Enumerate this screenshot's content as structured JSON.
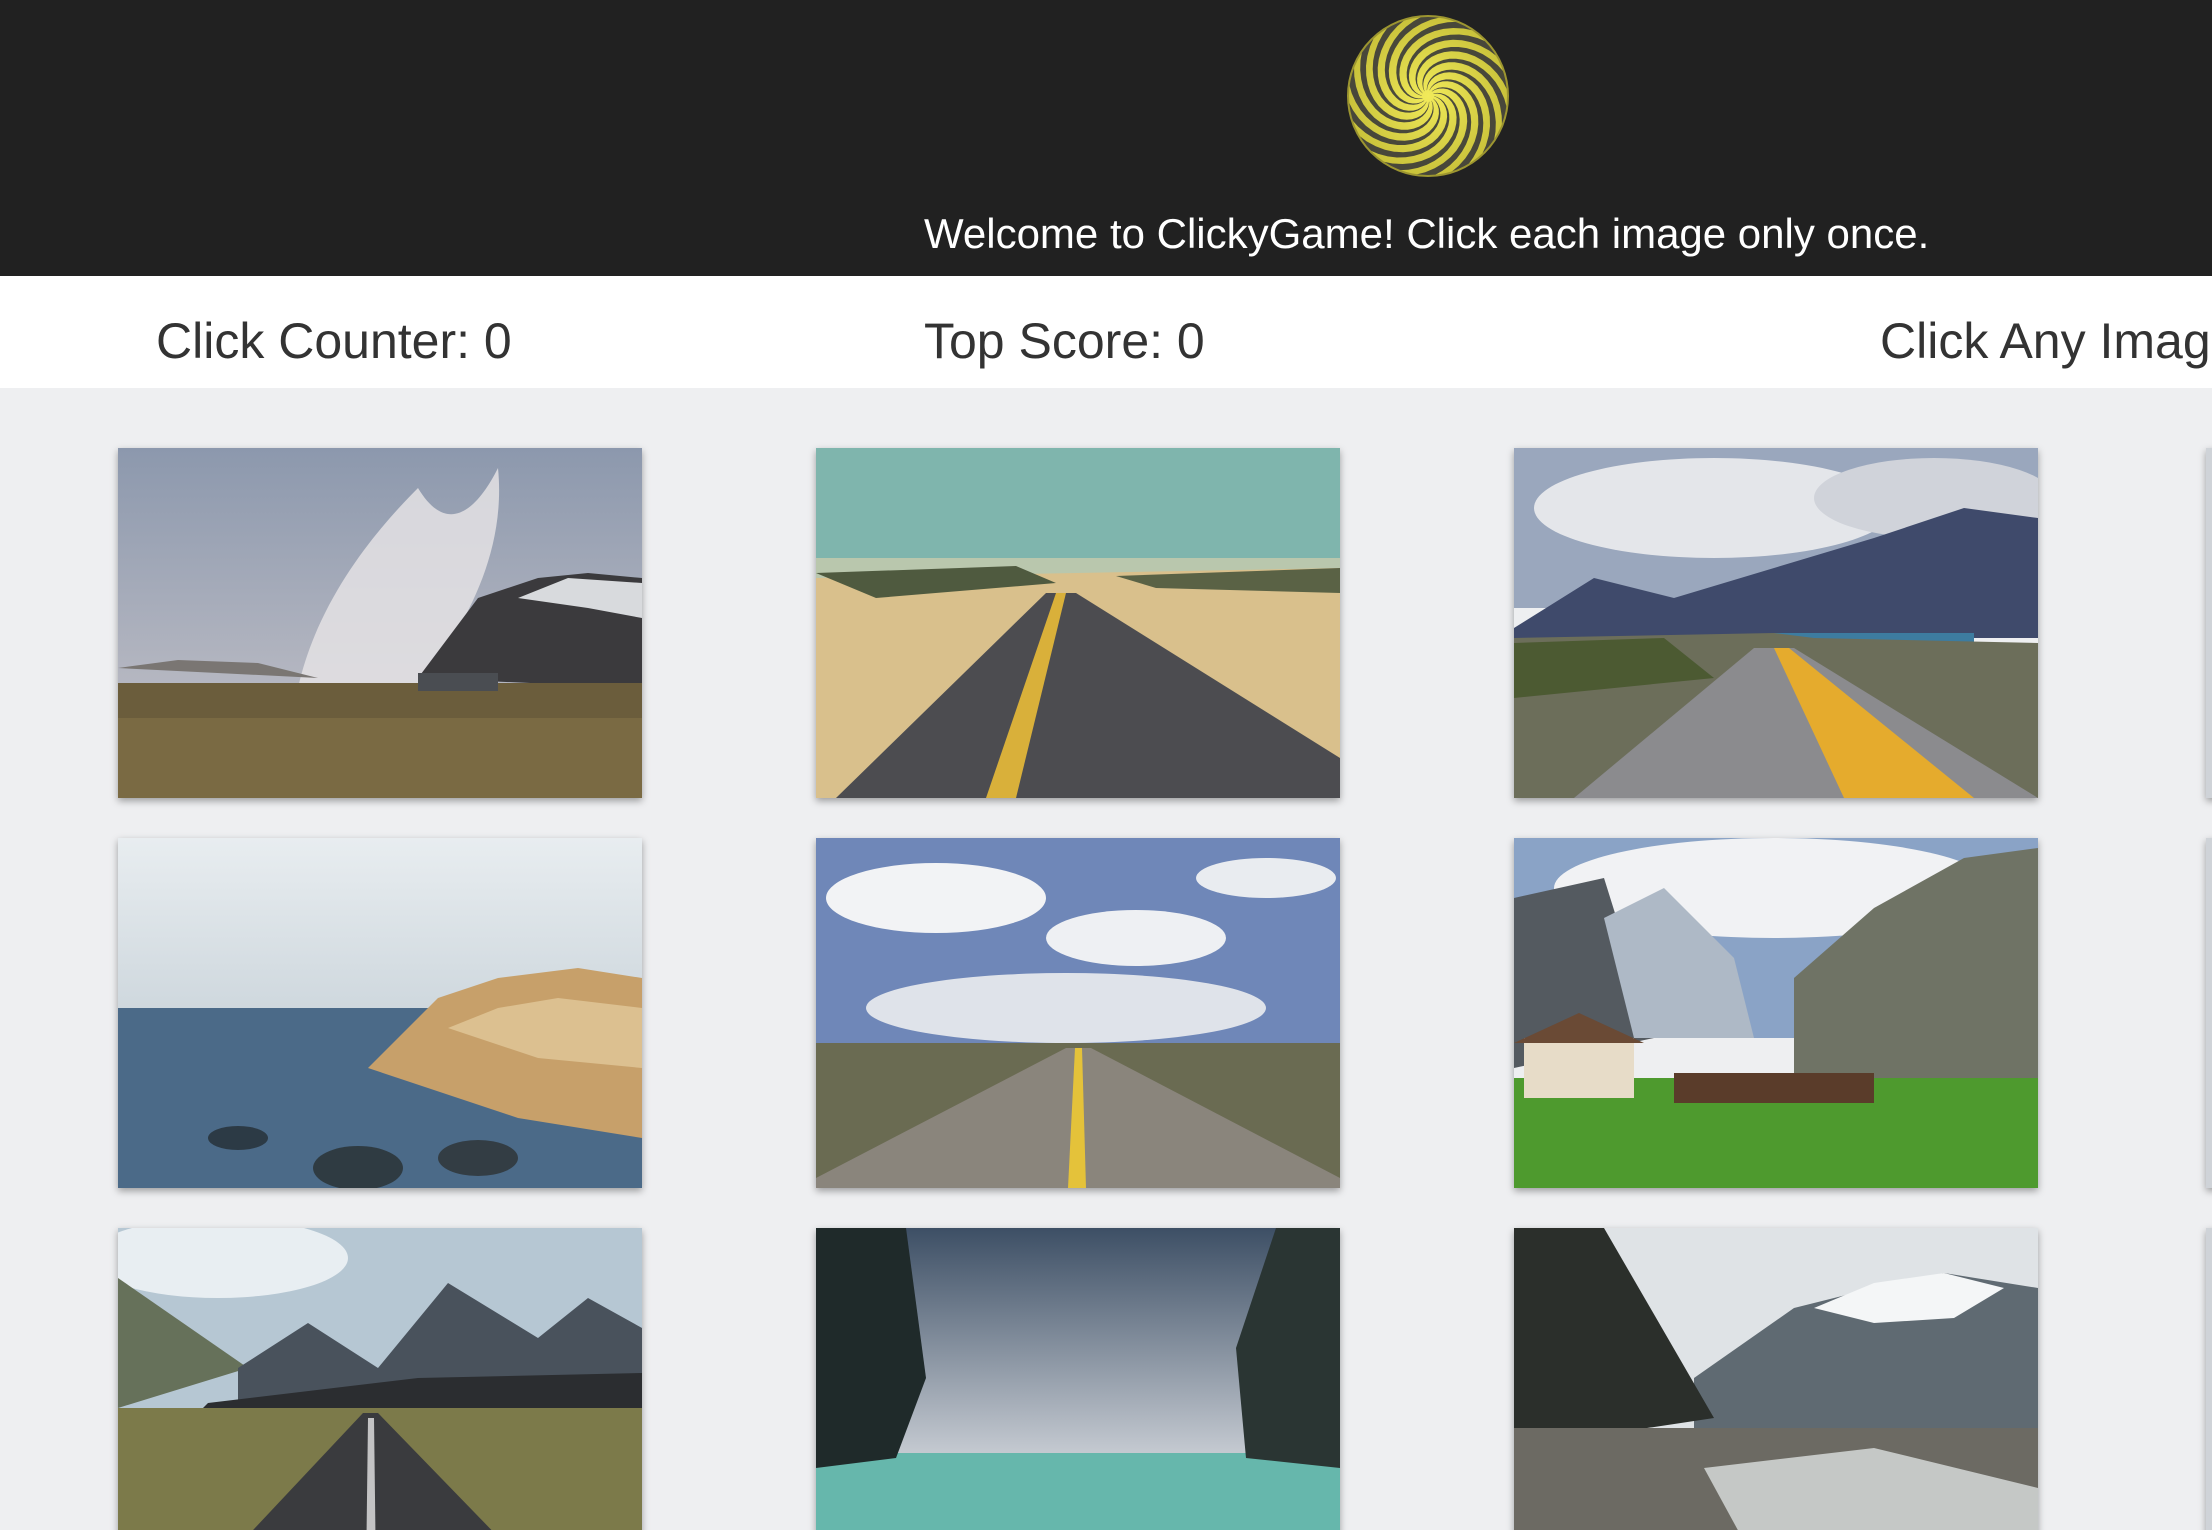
{
  "header": {
    "logo_icon": "spiral-logo-icon",
    "welcome_text": "Welcome to ClickyGame! Click each image only once."
  },
  "scoreboard": {
    "click_counter": "Click Counter: 0",
    "top_score": "Top Score: 0",
    "hint": "Click Any Image"
  },
  "gallery": {
    "tiles": [
      {
        "scene": "geothermal-steam-mountains"
      },
      {
        "scene": "desert-road-dunes"
      },
      {
        "scene": "mountain-lake-road"
      },
      {
        "scene": "rocky-sea-coast"
      },
      {
        "scene": "prairie-road-clouds"
      },
      {
        "scene": "alpine-valley-village"
      },
      {
        "scene": "mountain-road-hills"
      },
      {
        "scene": "sea-cliffs-lagoon"
      },
      {
        "scene": "glacier-river-valley"
      }
    ]
  },
  "colors": {
    "header_bg": "#212121",
    "scorebar_bg": "#ffffff",
    "page_bg": "#eeeff1",
    "logo_yellow": "#e8e04a"
  }
}
